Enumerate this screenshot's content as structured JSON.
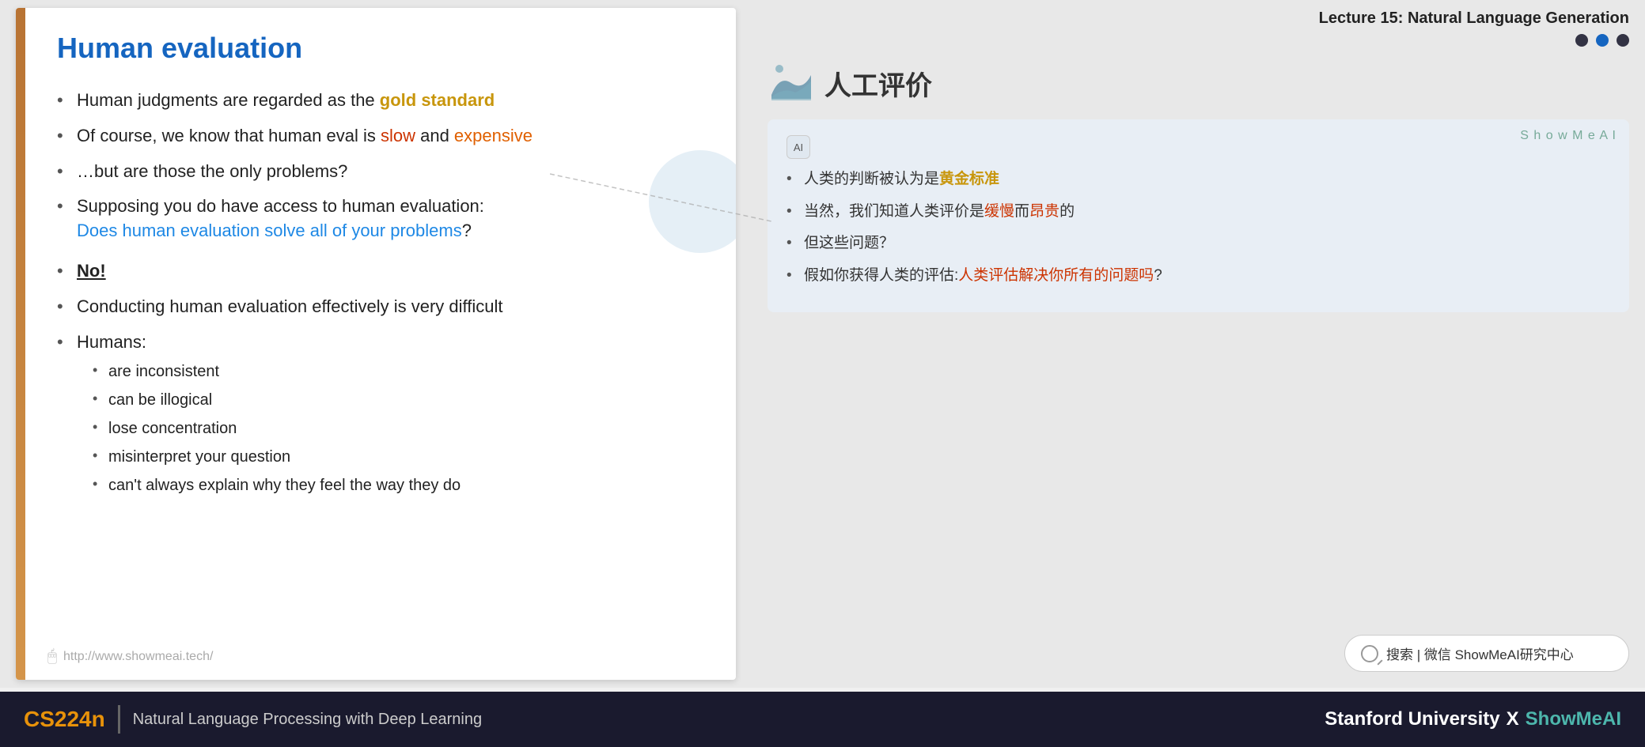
{
  "header": {
    "lecture_title": "Lecture 15: Natural Language Generation"
  },
  "slide": {
    "title": "Human evaluation",
    "bullet1": "Human judgments are regarded as the ",
    "bullet1_gold": "gold standard",
    "bullet2_pre": "Of course, we know that human eval is ",
    "bullet2_slow": "slow",
    "bullet2_mid": " and ",
    "bullet2_expensive": "expensive",
    "bullet3": "…but are those the only problems?",
    "bullet4_pre": "Supposing you do have access to human evaluation:",
    "bullet4_blue": "Does human evaluation solve all of your problems",
    "bullet4_end": "?",
    "bullet5": "No!",
    "bullet6": "Conducting human evaluation effectively is very difficult",
    "bullet7_pre": "Humans:",
    "sub_bullets": [
      "are inconsistent",
      "can be illogical",
      "lose concentration",
      "misinterpret your question",
      "can't always explain why they feel the way they do"
    ],
    "footer_url": "http://www.showmeai.tech/"
  },
  "right_panel": {
    "chinese_title": "人工评价",
    "showmeai_label": "S h o w M e A I",
    "ai_icon_label": "AI",
    "cn_bullet1_pre": "人类的判断被认为是",
    "cn_bullet1_gold": "黄金标准",
    "cn_bullet2_pre": "当然，我们知道人类评价是",
    "cn_bullet2_slow": "缓慢",
    "cn_bullet2_mid": "而",
    "cn_bullet2_expensive": "昂贵",
    "cn_bullet2_end": "的",
    "cn_bullet3": "但这些问题？",
    "cn_bullet4_pre": "假如你获得人类的评估:",
    "cn_bullet4_blue": "人类评估解决你所有的问题吗",
    "cn_bullet4_end": "?",
    "search_icon": "🔍",
    "search_text": "搜索 | 微信 ShowMeAI研究中心"
  },
  "dots": [
    {
      "active": false
    },
    {
      "active": true
    },
    {
      "active": false
    }
  ],
  "bottom_bar": {
    "cs_label": "CS224n",
    "subtitle": "Natural Language Processing with Deep Learning",
    "stanford": "Stanford University",
    "x": "X",
    "showmeai": "ShowMeAI"
  }
}
